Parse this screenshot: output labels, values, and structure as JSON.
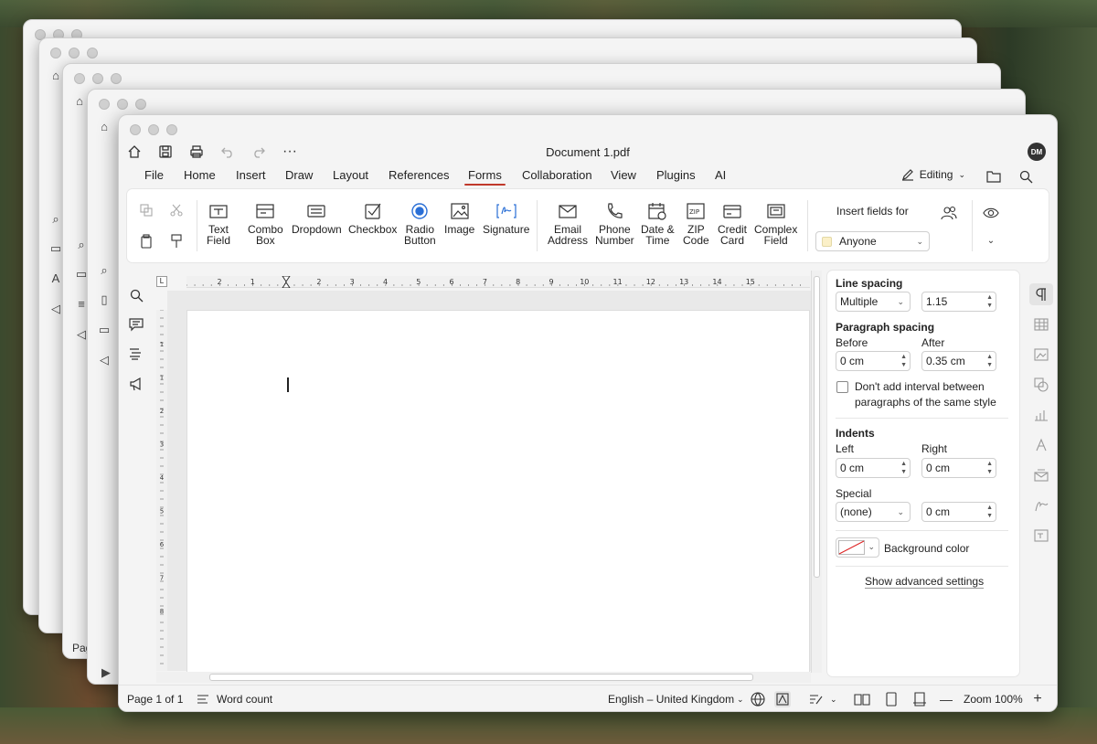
{
  "window": {
    "document_title": "Document 1.pdf",
    "avatar": "DM"
  },
  "menu": [
    "File",
    "Home",
    "Insert",
    "Draw",
    "Layout",
    "References",
    "Forms",
    "Collaboration",
    "View",
    "Plugins",
    "AI"
  ],
  "active_menu": "Forms",
  "editing_label": "Editing",
  "ribbon": {
    "text_field": [
      "Text",
      "Field"
    ],
    "combo_box": [
      "Combo",
      "Box"
    ],
    "dropdown": "Dropdown",
    "checkbox": "Checkbox",
    "radio_button": [
      "Radio",
      "Button"
    ],
    "image": "Image",
    "signature": "Signature",
    "email_address": [
      "Email",
      "Address"
    ],
    "phone_number": [
      "Phone",
      "Number"
    ],
    "date_time": [
      "Date &",
      "Time"
    ],
    "zip_code": [
      "ZIP",
      "Code"
    ],
    "credit_card": [
      "Credit",
      "Card"
    ],
    "complex_field": [
      "Complex",
      "Field"
    ],
    "insert_fields_for": "Insert fields for",
    "anyone": "Anyone"
  },
  "ruler": {
    "h_ticks": [
      "2",
      "1",
      "1",
      "2",
      "3",
      "4",
      "5",
      "6",
      "7",
      "8",
      "9",
      "10",
      "11",
      "12",
      "13",
      "14",
      "15"
    ],
    "v_ticks": [
      "1",
      "1",
      "2",
      "3",
      "4",
      "5",
      "6",
      "7",
      "8"
    ]
  },
  "panel": {
    "line_spacing": "Line spacing",
    "line_spacing_mode": "Multiple",
    "line_spacing_value": "1.15",
    "paragraph_spacing": "Paragraph spacing",
    "before": "Before",
    "after": "After",
    "before_value": "0 cm",
    "after_value": "0.35 cm",
    "no_interval": [
      "Don't add interval between",
      "paragraphs of the same style"
    ],
    "indents": "Indents",
    "left": "Left",
    "right": "Right",
    "left_value": "0 cm",
    "right_value": "0 cm",
    "special": "Special",
    "special_value": "(none)",
    "special_amount": "0 cm",
    "background_color": "Background color",
    "show_advanced": "Show advanced settings"
  },
  "status": {
    "page": "Page 1 of 1",
    "word_count": "Word count",
    "language": "English – United Kingdom",
    "zoom": "Zoom 100%"
  },
  "background_windows": {
    "page_label": "Pag"
  }
}
